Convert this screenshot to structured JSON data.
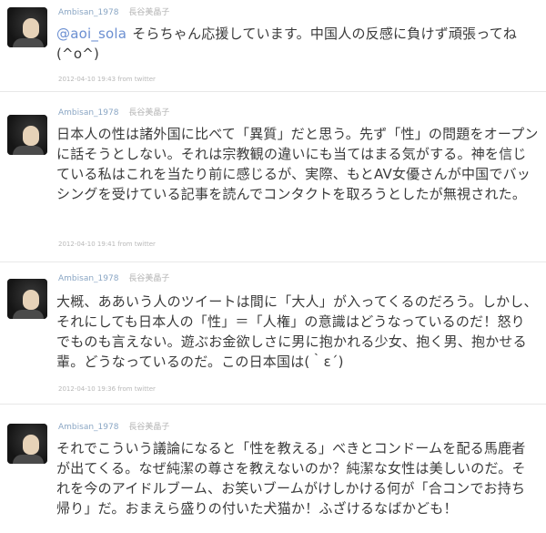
{
  "tweets": [
    {
      "screen_name": "Ambisan_1978",
      "full_name": "長谷美晶子",
      "mention": "@aoi_sola",
      "text": "そらちゃん応援しています。中国人の反感に負けず頑張ってね(^o^)",
      "timestamp": "2012-04-10 19:43 from twitter"
    },
    {
      "screen_name": "Ambisan_1978",
      "full_name": "長谷美晶子",
      "text": "日本人の性は諸外国に比べて「異質」だと思う。先ず「性」の問題をオープンに話そうとしない。それは宗教観の違いにも当てはまる気がする。神を信じている私はこれを当たり前に感じるが、実際、もとAV女優さんが中国でバッシングを受けている記事を読んでコンタクトを取ろうとしたが無視された。",
      "timestamp": "2012-04-10 19:41 from twitter"
    },
    {
      "screen_name": "Ambisan_1978",
      "full_name": "長谷美晶子",
      "text": "大概、ああいう人のツイートは間に「大人」が入ってくるのだろう。しかし、それにしても日本人の「性」＝「人権」の意識はどうなっているのだ！怒りでものも言えない。遊ぶお金欲しさに男に抱かれる少女、抱く男、抱かせる輩。どうなっているのだ。この日本国は(｀ε´)",
      "timestamp": "2012-04-10 19:36 from twitter"
    },
    {
      "screen_name": "Ambisan_1978",
      "full_name": "長谷美晶子",
      "text": "それでこういう議論になると「性を教える」べきとコンドームを配る馬鹿者が出てくる。なぜ純潔の尊さを教えないのか？純潔な女性は美しいのだ。それを今のアイドルブーム、お笑いブームがけしかける何が「合コンでお持ち帰り」だ。おまえら盛りの付いた犬猫か！ふざけるなばかども！",
      "timestamp": ""
    }
  ]
}
